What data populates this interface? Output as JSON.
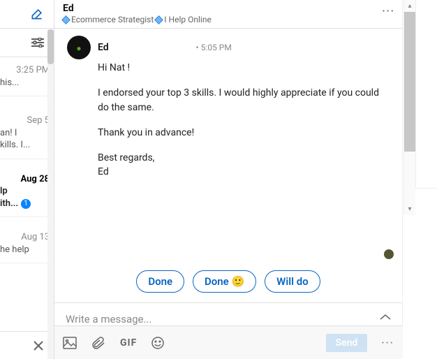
{
  "sidebar": {
    "items": [
      {
        "date": "3:25 PM",
        "preview": "his..."
      },
      {
        "date": "Sep 5",
        "preview1": "an! I",
        "preview2": "kills. I..."
      },
      {
        "date": "Aug 28",
        "preview1": "lp",
        "preview2": "ith...",
        "badge": "1",
        "active": true
      },
      {
        "date": "Aug 13",
        "preview": "he help"
      }
    ]
  },
  "header": {
    "name": "Ed",
    "sub1": "Ecommerce Strategist",
    "sub2": "I Help Online"
  },
  "message": {
    "sender": "Ed",
    "time": "• 5:05 PM",
    "greeting": "Hi Nat !",
    "para1": "I endorsed your top 3 skills. I would highly appreciate if you could do the same.",
    "para2": "Thank you in advance!",
    "sign1": "Best regards,",
    "sign2": "Ed"
  },
  "quick_replies": [
    "Done",
    "Done 🙂",
    "Will do"
  ],
  "compose": {
    "placeholder": "Write a message..."
  },
  "toolbar": {
    "gif": "GIF",
    "send": "Send"
  }
}
